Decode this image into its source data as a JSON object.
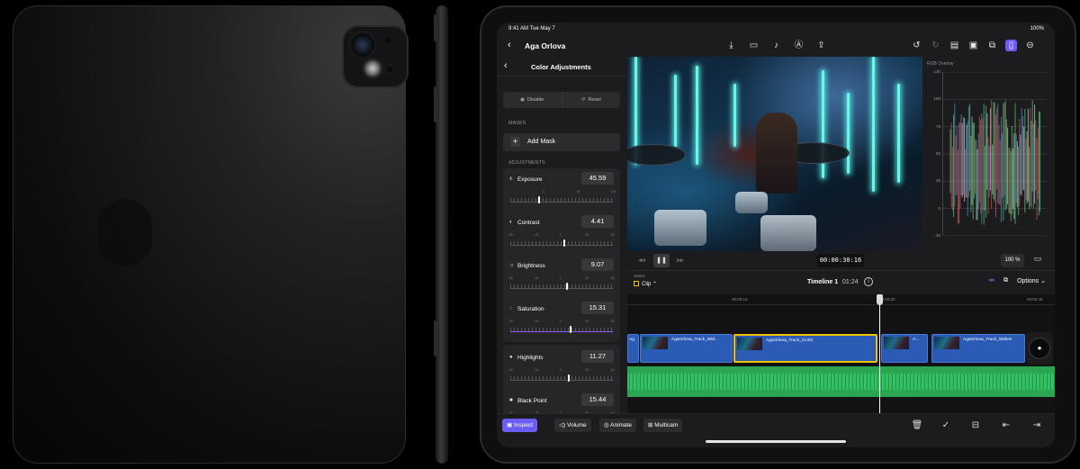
{
  "status_bar": {
    "time": "9:41 AM  Tue May 7",
    "battery": "100%"
  },
  "nav": {
    "back": "‹",
    "title": "Aga Orlova",
    "mid_icons": [
      "import-icon",
      "camera-icon",
      "microphone-icon",
      "voiceover-icon",
      "share-icon"
    ],
    "right_icons": [
      "undo-icon",
      "redo-icon",
      "viewer-layout-icon",
      "photos-icon",
      "multicam-icon",
      "inspector-toggle-icon",
      "more-icon"
    ]
  },
  "inspector": {
    "back": "‹",
    "title": "Color Adjustments",
    "disable_label": "Disable",
    "reset_label": "Reset",
    "masks_label": "MASKS",
    "add_mask_label": "Add Mask",
    "adjustments_label": "ADJUSTMENTS",
    "items": [
      {
        "icon": "exposure-icon",
        "glyph": "±",
        "name": "Exposure",
        "value": "45.59",
        "marker": 0.27,
        "labels": [
          "-",
          "0",
          "50",
          "100"
        ]
      },
      {
        "icon": "contrast-icon",
        "glyph": "◐",
        "name": "Contrast",
        "value": "4.41",
        "marker": 0.52,
        "labels": [
          "-50",
          "-25",
          "0",
          "25",
          "50"
        ]
      },
      {
        "icon": "brightness-icon",
        "glyph": "☼",
        "name": "Brightness",
        "value": "9.07",
        "marker": 0.54,
        "labels": [
          "-50",
          "-25",
          "0",
          "25",
          "50"
        ]
      },
      {
        "icon": "saturation-icon",
        "glyph": "◌",
        "name": "Saturation",
        "value": "15.31",
        "marker": 0.58,
        "labels": [
          "-50",
          "-25",
          "0",
          "25",
          "50"
        ]
      },
      {
        "icon": "highlights-icon",
        "glyph": "●",
        "name": "Highlights",
        "value": "11.27",
        "marker": 0.56,
        "labels": [
          "-50",
          "-25",
          "0",
          "25",
          "50"
        ]
      },
      {
        "icon": "black-point-icon",
        "glyph": "■",
        "name": "Black Point",
        "value": "15.44",
        "marker": 0.58,
        "labels": [
          "-50",
          "-25",
          "0",
          "25",
          "50"
        ]
      }
    ]
  },
  "histogram": {
    "label": "RGB Overlay",
    "axis": [
      "120",
      "100",
      "75",
      "50",
      "25",
      "0",
      "-20"
    ]
  },
  "transport": {
    "timecode": "00:00:30:16",
    "zoom": "100 %"
  },
  "timeline": {
    "select_label": "Select",
    "clip_label": "Clip",
    "title": "Timeline 1",
    "duration": "01:24",
    "options_label": "Options",
    "ruler": [
      "00:00:15",
      "00:00:30",
      "00:00:45"
    ],
    "clips": [
      {
        "name": "Ag",
        "selected": false
      },
      {
        "name": "AgaOrlova_Track_Wid...",
        "selected": false
      },
      {
        "name": "AgaOrlova_Track_CU03",
        "selected": true
      },
      {
        "name": "A...",
        "selected": false
      },
      {
        "name": "AgaOrlova_Track_WideG",
        "selected": false
      }
    ]
  },
  "bottom_bar": {
    "inspect": "Inspect",
    "volume": "Volume",
    "animate": "Animate",
    "multicam": "Multicam"
  },
  "colors": {
    "accent": "#6b5cf5",
    "clip_blue": "#2c5bb6",
    "audio_green": "#2aa552",
    "selection_yellow": "#f2c200"
  }
}
